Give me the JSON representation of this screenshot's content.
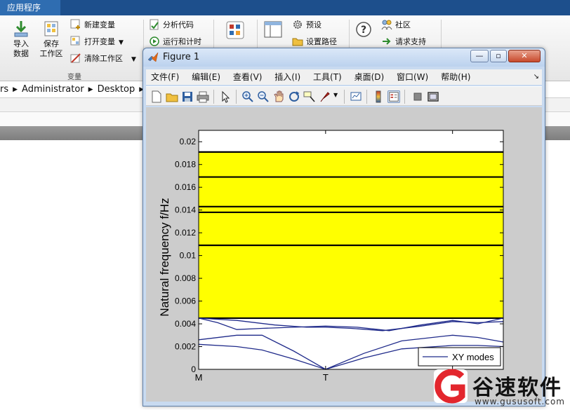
{
  "app": {
    "active_tab": "应用程序"
  },
  "ribbon": {
    "import_data": [
      "导入",
      "数据"
    ],
    "save_workspace": [
      "保存",
      "工作区"
    ],
    "new_variable": "新建变量",
    "open_variable": "打开变量",
    "clear_workspace": "清除工作区",
    "variable_group": "变量",
    "analyze_code": "分析代码",
    "run_and_time": "运行和计时",
    "preferences": "预设",
    "set_path": "设置路径",
    "community": "社区",
    "request_support": "请求支持"
  },
  "address": {
    "crumbs": [
      "rs",
      "Administrator",
      "Desktop"
    ]
  },
  "figure": {
    "title": "Figure 1",
    "menu": [
      "文件(F)",
      "编辑(E)",
      "查看(V)",
      "插入(I)",
      "工具(T)",
      "桌面(D)",
      "窗口(W)",
      "帮助(H)"
    ],
    "window_buttons": {
      "minimize": "—",
      "restore": "▫",
      "close": "✕"
    }
  },
  "chart_data": {
    "type": "line",
    "title": "",
    "ylabel": "Natural frequency f/Hz",
    "xlabel": "",
    "x_ticks": [
      {
        "pos": 0,
        "label": "M"
      },
      {
        "pos": 1,
        "label": "T"
      },
      {
        "pos": 2,
        "label": "X"
      }
    ],
    "xlim": [
      0,
      2.4
    ],
    "ylim": [
      0,
      0.021
    ],
    "y_ticks": [
      0,
      0.002,
      0.004,
      0.006,
      0.008,
      0.01,
      0.012,
      0.014,
      0.016,
      0.018,
      0.02
    ],
    "y_tick_labels": [
      "0",
      "0.002",
      "0.004",
      "0.006",
      "0.008",
      "0.01",
      "0.012",
      "0.014",
      "0.016",
      "0.018",
      "0.02"
    ],
    "bandgap": {
      "from": 0.0045,
      "to": 0.0191,
      "color": "#ffff00"
    },
    "flat_lines": [
      0.0045,
      0.0109,
      0.0138,
      0.0143,
      0.0169,
      0.0191
    ],
    "curve_color": "#1f2a8a",
    "legend": {
      "label": "XY modes",
      "position": "bottom-right"
    },
    "series": [
      {
        "x": [
          0,
          0.3,
          0.6,
          0.85,
          1.0,
          1.2,
          1.45,
          1.75,
          2.0,
          2.2,
          2.4
        ],
        "y": [
          0.0045,
          0.0043,
          0.0039,
          0.0037,
          0.0037,
          0.0036,
          0.0034,
          0.0038,
          0.0042,
          0.0041,
          0.0042
        ]
      },
      {
        "x": [
          0,
          0.15,
          0.3,
          0.5,
          0.75,
          1.0,
          1.25,
          1.5,
          1.75,
          2.0,
          2.2,
          2.4
        ],
        "y": [
          0.0045,
          0.0041,
          0.0035,
          0.0036,
          0.0037,
          0.0038,
          0.0037,
          0.0034,
          0.0039,
          0.0043,
          0.004,
          0.0045
        ]
      },
      {
        "x": [
          0,
          0.3,
          0.5,
          0.75,
          1.0,
          1.3,
          1.6,
          2.0,
          2.2,
          2.4
        ],
        "y": [
          0.0026,
          0.003,
          0.003,
          0.0016,
          0.0,
          0.0014,
          0.0025,
          0.003,
          0.0028,
          0.0024
        ]
      },
      {
        "x": [
          0,
          0.3,
          0.5,
          0.75,
          1.0,
          1.3,
          1.6,
          2.0,
          2.2,
          2.4
        ],
        "y": [
          0.0022,
          0.002,
          0.0017,
          0.0009,
          0.0,
          0.001,
          0.0018,
          0.0021,
          0.0021,
          0.002
        ]
      }
    ]
  },
  "watermark": {
    "text": "谷速软件",
    "url": "www.gususoft.com"
  }
}
